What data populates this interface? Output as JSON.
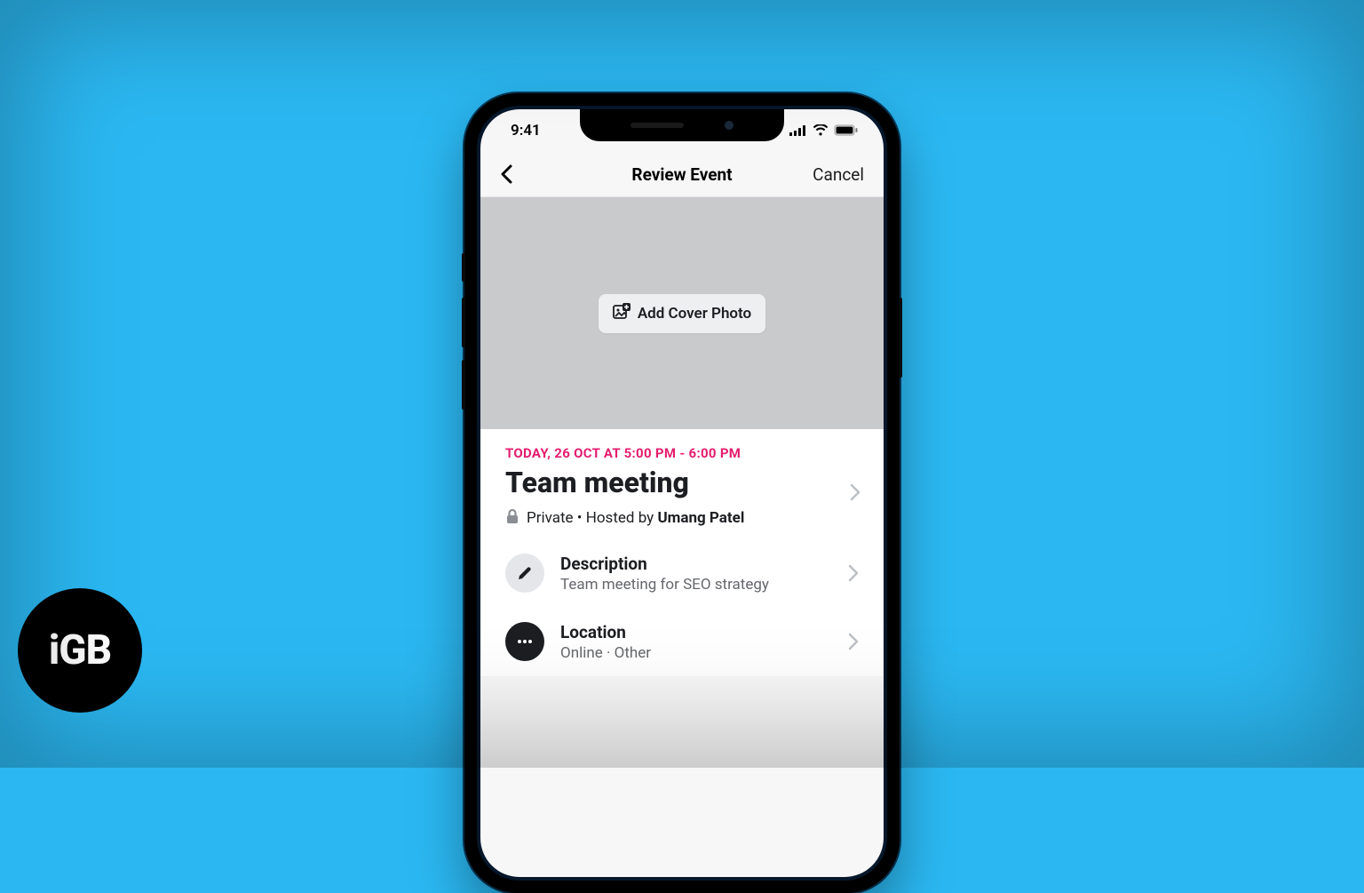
{
  "status": {
    "time": "9:41"
  },
  "nav": {
    "title": "Review Event",
    "cancel": "Cancel"
  },
  "cover": {
    "button_label": "Add Cover Photo"
  },
  "event": {
    "datetime": "TODAY, 26 OCT AT 5:00 PM - 6:00 PM",
    "title": "Team meeting",
    "privacy": "Private",
    "hosted_prefix": "Hosted by",
    "host": "Umang Patel"
  },
  "rows": {
    "description": {
      "title": "Description",
      "subtitle": "Team meeting for SEO strategy"
    },
    "location": {
      "title": "Location",
      "subtitle": "Online · Other"
    }
  },
  "badge": {
    "text": "iGB"
  }
}
